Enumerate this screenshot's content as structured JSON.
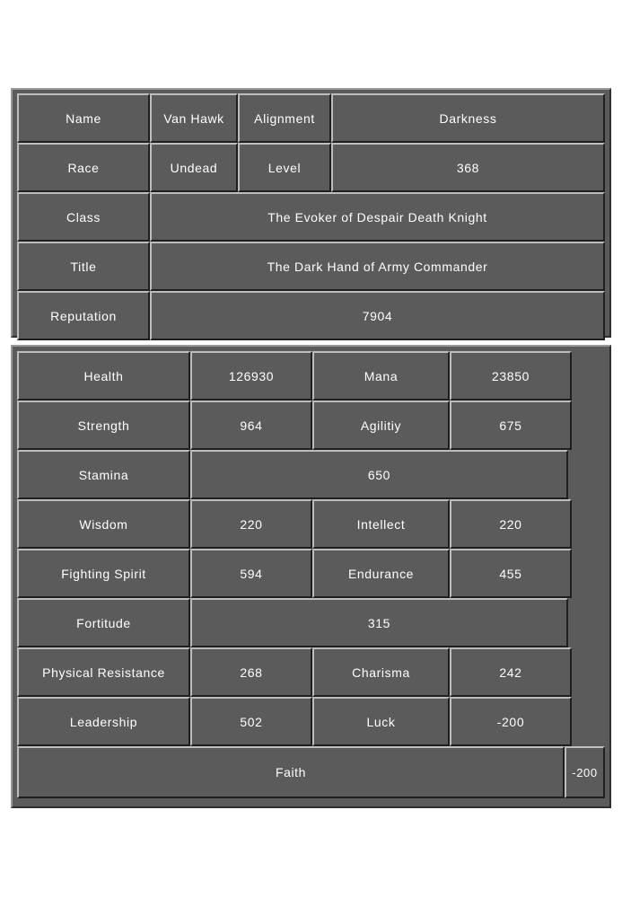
{
  "identity": {
    "rows": [
      {
        "label": "Name",
        "value": "Van Hawk",
        "label2": "Alignment",
        "value2": "Darkness",
        "layout": "four"
      },
      {
        "label": "Race",
        "value": "Undead",
        "label2": "Level",
        "value2": "368",
        "layout": "four"
      },
      {
        "label": "Class",
        "value": "The Evoker of Despair Death Knight",
        "layout": "two"
      },
      {
        "label": "Title",
        "value": "The Dark Hand of Army Commander",
        "layout": "two"
      },
      {
        "label": "Reputation",
        "value": "7904",
        "layout": "two"
      }
    ]
  },
  "stats": {
    "rows": [
      {
        "label": "Health",
        "value": "126930",
        "label2": "Mana",
        "value2": "23850",
        "layout": "four"
      },
      {
        "label": "Strength",
        "value": "964",
        "label2": "Agilitiy",
        "value2": "675",
        "layout": "four"
      },
      {
        "label": "Stamina",
        "value": "650",
        "layout": "two"
      },
      {
        "label": "Wisdom",
        "value": "220",
        "label2": "Intellect",
        "value2": "220",
        "layout": "four"
      },
      {
        "label": "Fighting Spirit",
        "value": "594",
        "label2": "Endurance",
        "value2": "455",
        "layout": "four"
      },
      {
        "label": "Fortitude",
        "value": "315",
        "layout": "two"
      },
      {
        "label": "Physical Resistance",
        "value": "268",
        "label2": "Charisma",
        "value2": "242",
        "layout": "four"
      },
      {
        "label": "Leadership",
        "value": "502",
        "label2": "Luck",
        "value2": "-200",
        "layout": "four"
      }
    ],
    "faith": {
      "label": "Faith",
      "value": "-200"
    }
  },
  "colors": {
    "page_background": "#ffffff",
    "panel_fill": "#5b5b5b",
    "cell_fill": "#5b5b5b",
    "bevel_light": "#bdbdbd",
    "bevel_dark": "#1f1f1f",
    "text": "#ffffff"
  }
}
